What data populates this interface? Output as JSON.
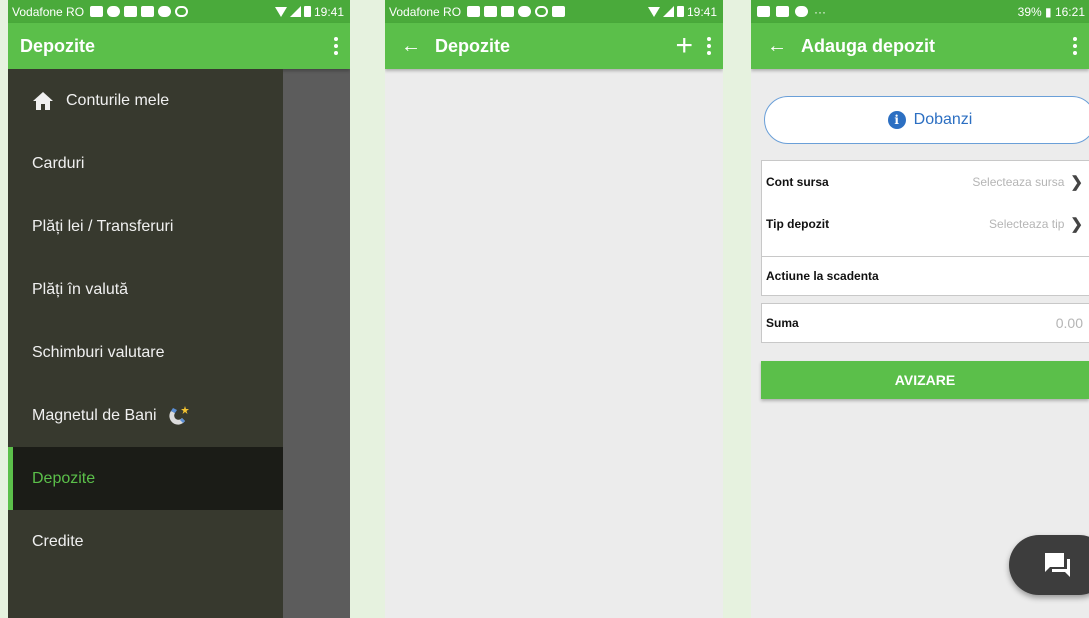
{
  "screen1": {
    "status": {
      "carrier": "Vodafone RO",
      "time": "19:41"
    },
    "appbar": {
      "title": "Depozite"
    },
    "drawer": {
      "items": [
        {
          "label": "Conturile mele"
        },
        {
          "label": "Carduri"
        },
        {
          "label": "Plăți lei / Transferuri"
        },
        {
          "label": "Plăți în valută"
        },
        {
          "label": "Schimburi valutare"
        },
        {
          "label": "Magnetul de Bani"
        },
        {
          "label": "Depozite",
          "active": true
        },
        {
          "label": "Credite"
        }
      ]
    }
  },
  "screen2": {
    "status": {
      "carrier": "Vodafone RO",
      "time": "19:41"
    },
    "appbar": {
      "title": "Depozite"
    }
  },
  "screen3": {
    "status": {
      "dots": "···",
      "right": "39% ▮ 16:21"
    },
    "appbar": {
      "title": "Adauga depozit"
    },
    "info_button": {
      "label": "Dobanzi"
    },
    "fields": {
      "cont_sursa": {
        "label": "Cont sursa",
        "placeholder": "Selecteaza sursa"
      },
      "tip_depozit": {
        "label": "Tip depozit",
        "placeholder": "Selecteaza tip"
      },
      "actiune": {
        "label": "Actiune la scadenta"
      },
      "suma": {
        "label": "Suma",
        "value": "0.00"
      }
    },
    "submit": {
      "label": "AVIZARE"
    }
  },
  "colors": {
    "green_bar": "#5bbf4a",
    "status_green": "#4aaa3b",
    "drawer_bg": "#37392e",
    "link_blue": "#2c6fc2"
  }
}
